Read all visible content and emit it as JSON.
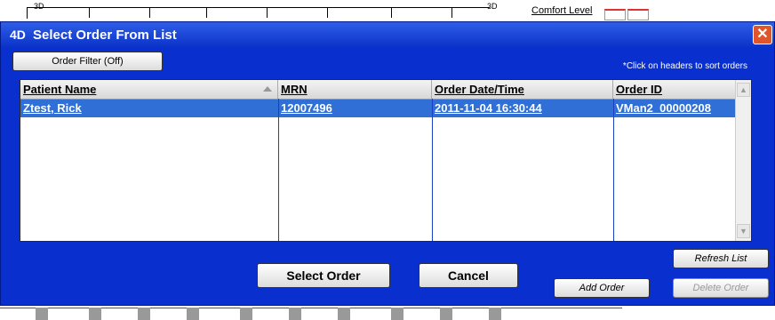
{
  "background": {
    "ruler_numbers": [
      "3D",
      "3D"
    ],
    "comfort_label": "Comfort Level"
  },
  "dialog": {
    "title": "Select Order From List",
    "logo": "4D",
    "close": "✕",
    "order_filter_label": "Order Filter (Off)",
    "sort_hint": "*Click on headers to sort orders",
    "columns": [
      "Patient Name",
      "MRN",
      "Order Date/Time",
      "Order ID"
    ],
    "rows": [
      {
        "patient_name": "Ztest, Rick",
        "mrn": "12007496",
        "order_datetime": "2011-11-04  16:30:44",
        "order_id": "VMan2_00000208"
      }
    ],
    "buttons": {
      "refresh": "Refresh List",
      "select": "Select Order",
      "cancel": "Cancel",
      "add": "Add Order",
      "delete": "Delete Order"
    }
  },
  "colors": {
    "dialog_bg": "#0a2fcf",
    "selected_row": "#2f6fd6",
    "close_button": "#e0552a"
  }
}
